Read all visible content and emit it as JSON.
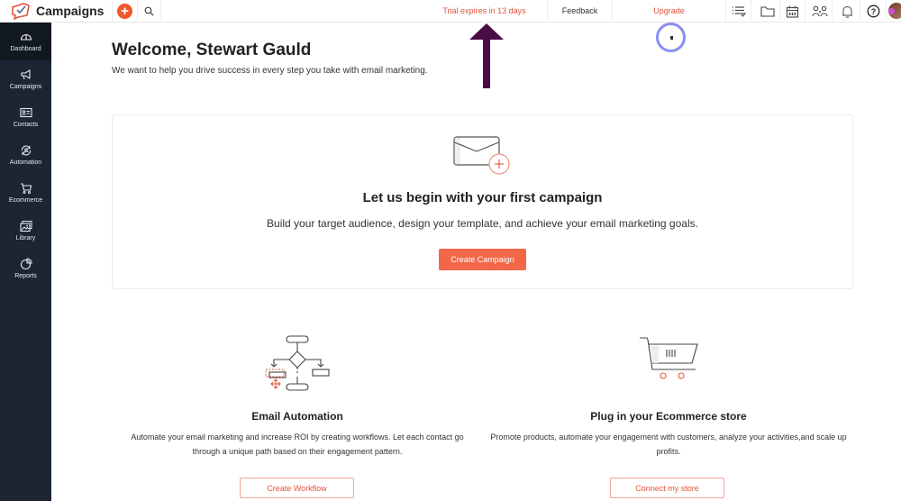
{
  "app": {
    "name": "Campaigns",
    "accent_color": "#f26748"
  },
  "topbar": {
    "trial_text": "Trial expires in 13 days",
    "feedback_label": "Feedback",
    "upgrade_label": "Upgrade",
    "icons": [
      "list-filter-icon",
      "folder-icon",
      "calendar-icon",
      "users-icon",
      "bell-icon",
      "help-icon"
    ]
  },
  "sidebar": {
    "items": [
      {
        "label": "Dashboard",
        "icon": "dashboard-icon",
        "active": true
      },
      {
        "label": "Campaigns",
        "icon": "megaphone-icon",
        "active": false
      },
      {
        "label": "Contacts",
        "icon": "contact-card-icon",
        "active": false
      },
      {
        "label": "Automation",
        "icon": "automation-icon",
        "active": false
      },
      {
        "label": "Ecommerce",
        "icon": "cart-icon",
        "active": false
      },
      {
        "label": "Library",
        "icon": "image-library-icon",
        "active": false
      },
      {
        "label": "Reports",
        "icon": "pie-chart-icon",
        "active": false
      }
    ]
  },
  "main": {
    "welcome_title": "Welcome, Stewart Gauld",
    "welcome_subtitle": "We want to help you drive success in every step you take with email marketing.",
    "first_campaign": {
      "title": "Let us begin with your first campaign",
      "subtitle": "Build your target audience, design your template, and achieve your email marketing goals.",
      "button": "Create Campaign"
    },
    "features": [
      {
        "title": "Email Automation",
        "description": "Automate your email marketing and increase ROI by creating workflows. Let each contact go through a unique path based on their engagement pattern.",
        "button": "Create Workflow"
      },
      {
        "title": "Plug in your Ecommerce store",
        "description": "Promote products, automate your engagement with customers, analyze your activities,and scale up profits.",
        "button": "Connect my store"
      }
    ]
  }
}
